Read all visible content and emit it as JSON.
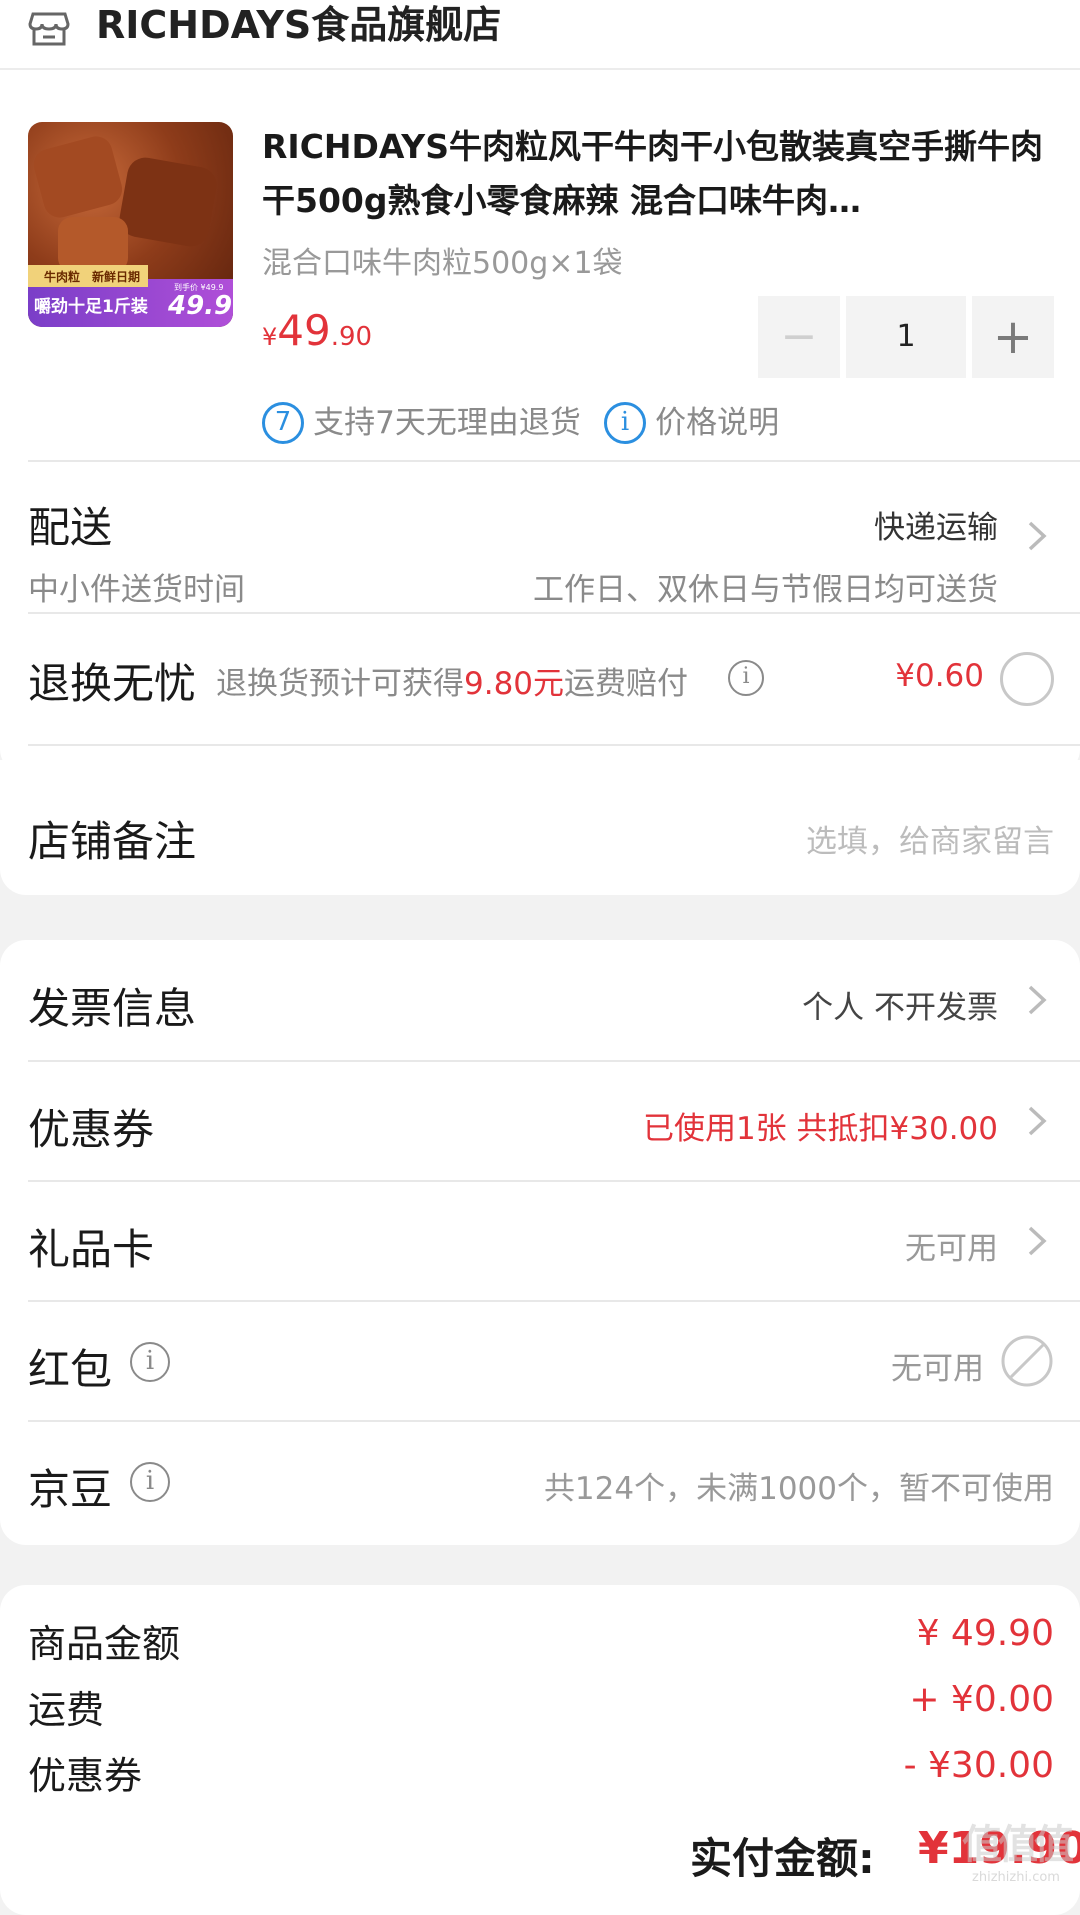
{
  "store": {
    "icon": "store-icon",
    "name": "RICHDAYS食品旗舰店"
  },
  "product": {
    "title": "RICHDAYS牛肉粒风干牛肉干小包散装真空手撕牛肉干500g熟食小零食麻辣 混合口味牛肉…",
    "spec": "混合口味牛肉粒500g×1袋",
    "price_symbol": "¥",
    "price_int": "49",
    "price_dec": ".90",
    "quantity": "1",
    "minus": "−",
    "plus": "+",
    "image_text": {
      "tag1": "牛肉粒",
      "tag2": "新鲜日期",
      "banner": "嚼劲十足1斤装",
      "price": "49.9",
      "small": "到手价 ¥49.9"
    },
    "return_badge": "7",
    "return_text": "支持7天无理由退货",
    "price_info_badge": "i",
    "price_info_text": "价格说明"
  },
  "delivery": {
    "label": "配送",
    "method": "快递运输",
    "sub_label": "中小件送货时间",
    "sub_value": "工作日、双休日与节假日均可送货"
  },
  "return_worry_free": {
    "label": "退换无忧",
    "desc_prefix": "退换货预计可获得",
    "desc_amount": "9.80元",
    "desc_suffix": "运费赔付",
    "price": "¥0.60"
  },
  "store_note": {
    "label": "店铺备注",
    "placeholder": "选填，给商家留言"
  },
  "invoice": {
    "label": "发票信息",
    "value": "个人 不开发票"
  },
  "coupon": {
    "label": "优惠券",
    "value": "已使用1张 共抵扣¥30.00"
  },
  "gift_card": {
    "label": "礼品卡",
    "value": "无可用"
  },
  "red_packet": {
    "label": "红包",
    "value": "无可用"
  },
  "jingdou": {
    "label": "京豆",
    "value": "共124个，未满1000个，暂不可使用"
  },
  "summary": {
    "goods_label": "商品金额",
    "goods_value": "¥ 49.90",
    "shipping_label": "运费",
    "shipping_value": "+ ¥0.00",
    "coupon_label": "优惠券",
    "coupon_value": "- ¥30.00",
    "total_label": "实付金额:",
    "total_value": "¥19.90"
  },
  "watermark": {
    "text": "值值值",
    "url": "zhizhizhi.com"
  },
  "colors": {
    "accent_red": "#e2333a",
    "info_blue": "#2b8fe0"
  }
}
